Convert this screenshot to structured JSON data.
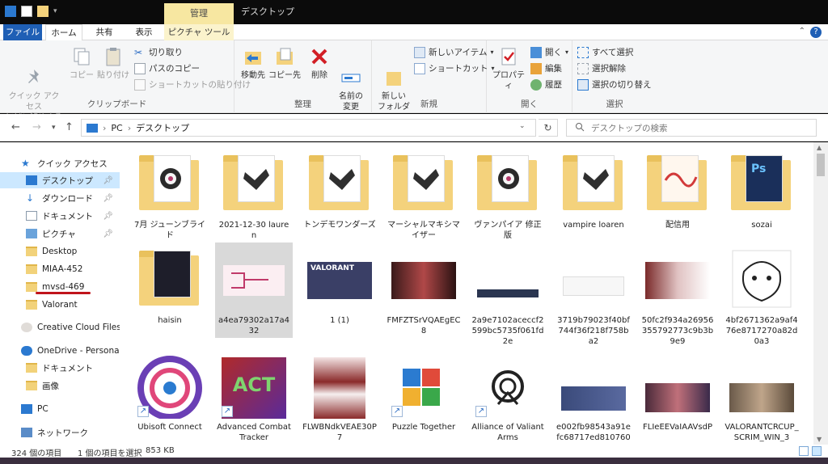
{
  "window": {
    "title": "デスクトップ",
    "context_tab": "管理"
  },
  "tabs": {
    "file": "ファイル",
    "home": "ホーム",
    "share": "共有",
    "view": "表示",
    "picture": "ピクチャ ツール"
  },
  "ribbon": {
    "clipboard": {
      "label": "クリップボード",
      "pin_quick": "クイック アクセス\nにピン留めする",
      "copy": "コピー",
      "paste": "貼り付け",
      "cut": "切り取り",
      "copy_path": "パスのコピー",
      "paste_shortcut": "ショートカットの貼り付け"
    },
    "organize": {
      "label": "整理",
      "move_to": "移動先",
      "copy_to": "コピー先",
      "delete": "削除",
      "rename": "名前の\n変更"
    },
    "new": {
      "label": "新規",
      "new_folder": "新しい\nフォルダー",
      "new_item": "新しいアイテム",
      "shortcut": "ショートカット"
    },
    "open": {
      "label": "開く",
      "properties": "プロパティ",
      "open": "開く",
      "edit": "編集",
      "history": "履歴"
    },
    "select": {
      "label": "選択",
      "select_all": "すべて選択",
      "select_none": "選択解除",
      "invert": "選択の切り替え"
    }
  },
  "address": {
    "pc": "PC",
    "location": "デスクトップ",
    "search_placeholder": "デスクトップの検索"
  },
  "nav": {
    "quick_access": "クイック アクセス",
    "desktop": "デスクトップ",
    "downloads": "ダウンロード",
    "documents": "ドキュメント",
    "pictures": "ピクチャ",
    "f_desktop": "Desktop",
    "f_miaa": "MIAA-452",
    "f_mvsd": "mvsd-469",
    "f_valorant": "Valorant",
    "creative_cloud": "Creative Cloud Files",
    "onedrive": "OneDrive - Personal",
    "od_documents": "ドキュメント",
    "od_images": "画像",
    "pc": "PC",
    "network": "ネットワーク"
  },
  "files": {
    "r1": [
      {
        "name": "7月 ジューンブライド"
      },
      {
        "name": "2021-12-30 lauren"
      },
      {
        "name": "トンデモワンダーズ"
      },
      {
        "name": "マーシャルマキシマイザー"
      },
      {
        "name": "ヴァンパイア 修正版"
      },
      {
        "name": "vampire loaren"
      },
      {
        "name": "配信用"
      },
      {
        "name": "sozai"
      }
    ],
    "r2": [
      {
        "name": "haisin"
      },
      {
        "name": "a4ea79302a17a432"
      },
      {
        "name": "1 (1)"
      },
      {
        "name": "FMFZTSrVQAEgEC8"
      },
      {
        "name": "2a9e7102aceccf2599bc5735f061fd2e"
      },
      {
        "name": "3719b79023f40bf744f36f218f758ba2"
      },
      {
        "name": "50fc2f934a26956355792773c9b3b9e9"
      },
      {
        "name": "4bf2671362a9af476e8717270a82d0a3"
      }
    ],
    "r3": [
      {
        "name": "Ubisoft Connect"
      },
      {
        "name": "Advanced Combat Tracker"
      },
      {
        "name": "FLWBNdkVEAE30P7"
      },
      {
        "name": "Puzzle Together"
      },
      {
        "name": "Alliance of Valiant Arms"
      },
      {
        "name": "e002fb98543a91efc68717ed810760"
      },
      {
        "name": "FLIeEEVaIAAVsdP"
      },
      {
        "name": "VALORANTCRCUP_SCRIM_WIN_3"
      }
    ]
  },
  "thumbs": {
    "valorant_text": "VALORANT",
    "act_text": "ACT",
    "ps_text": "Ps"
  },
  "status": {
    "count": "324 個の項目",
    "selected": "1 個の項目を選択",
    "size": "853 KB"
  },
  "colors": {
    "accent": "#1f5fb5",
    "context_tab": "#f7e7a1",
    "selection": "#cce8ff",
    "folder": "#f4d27c"
  }
}
